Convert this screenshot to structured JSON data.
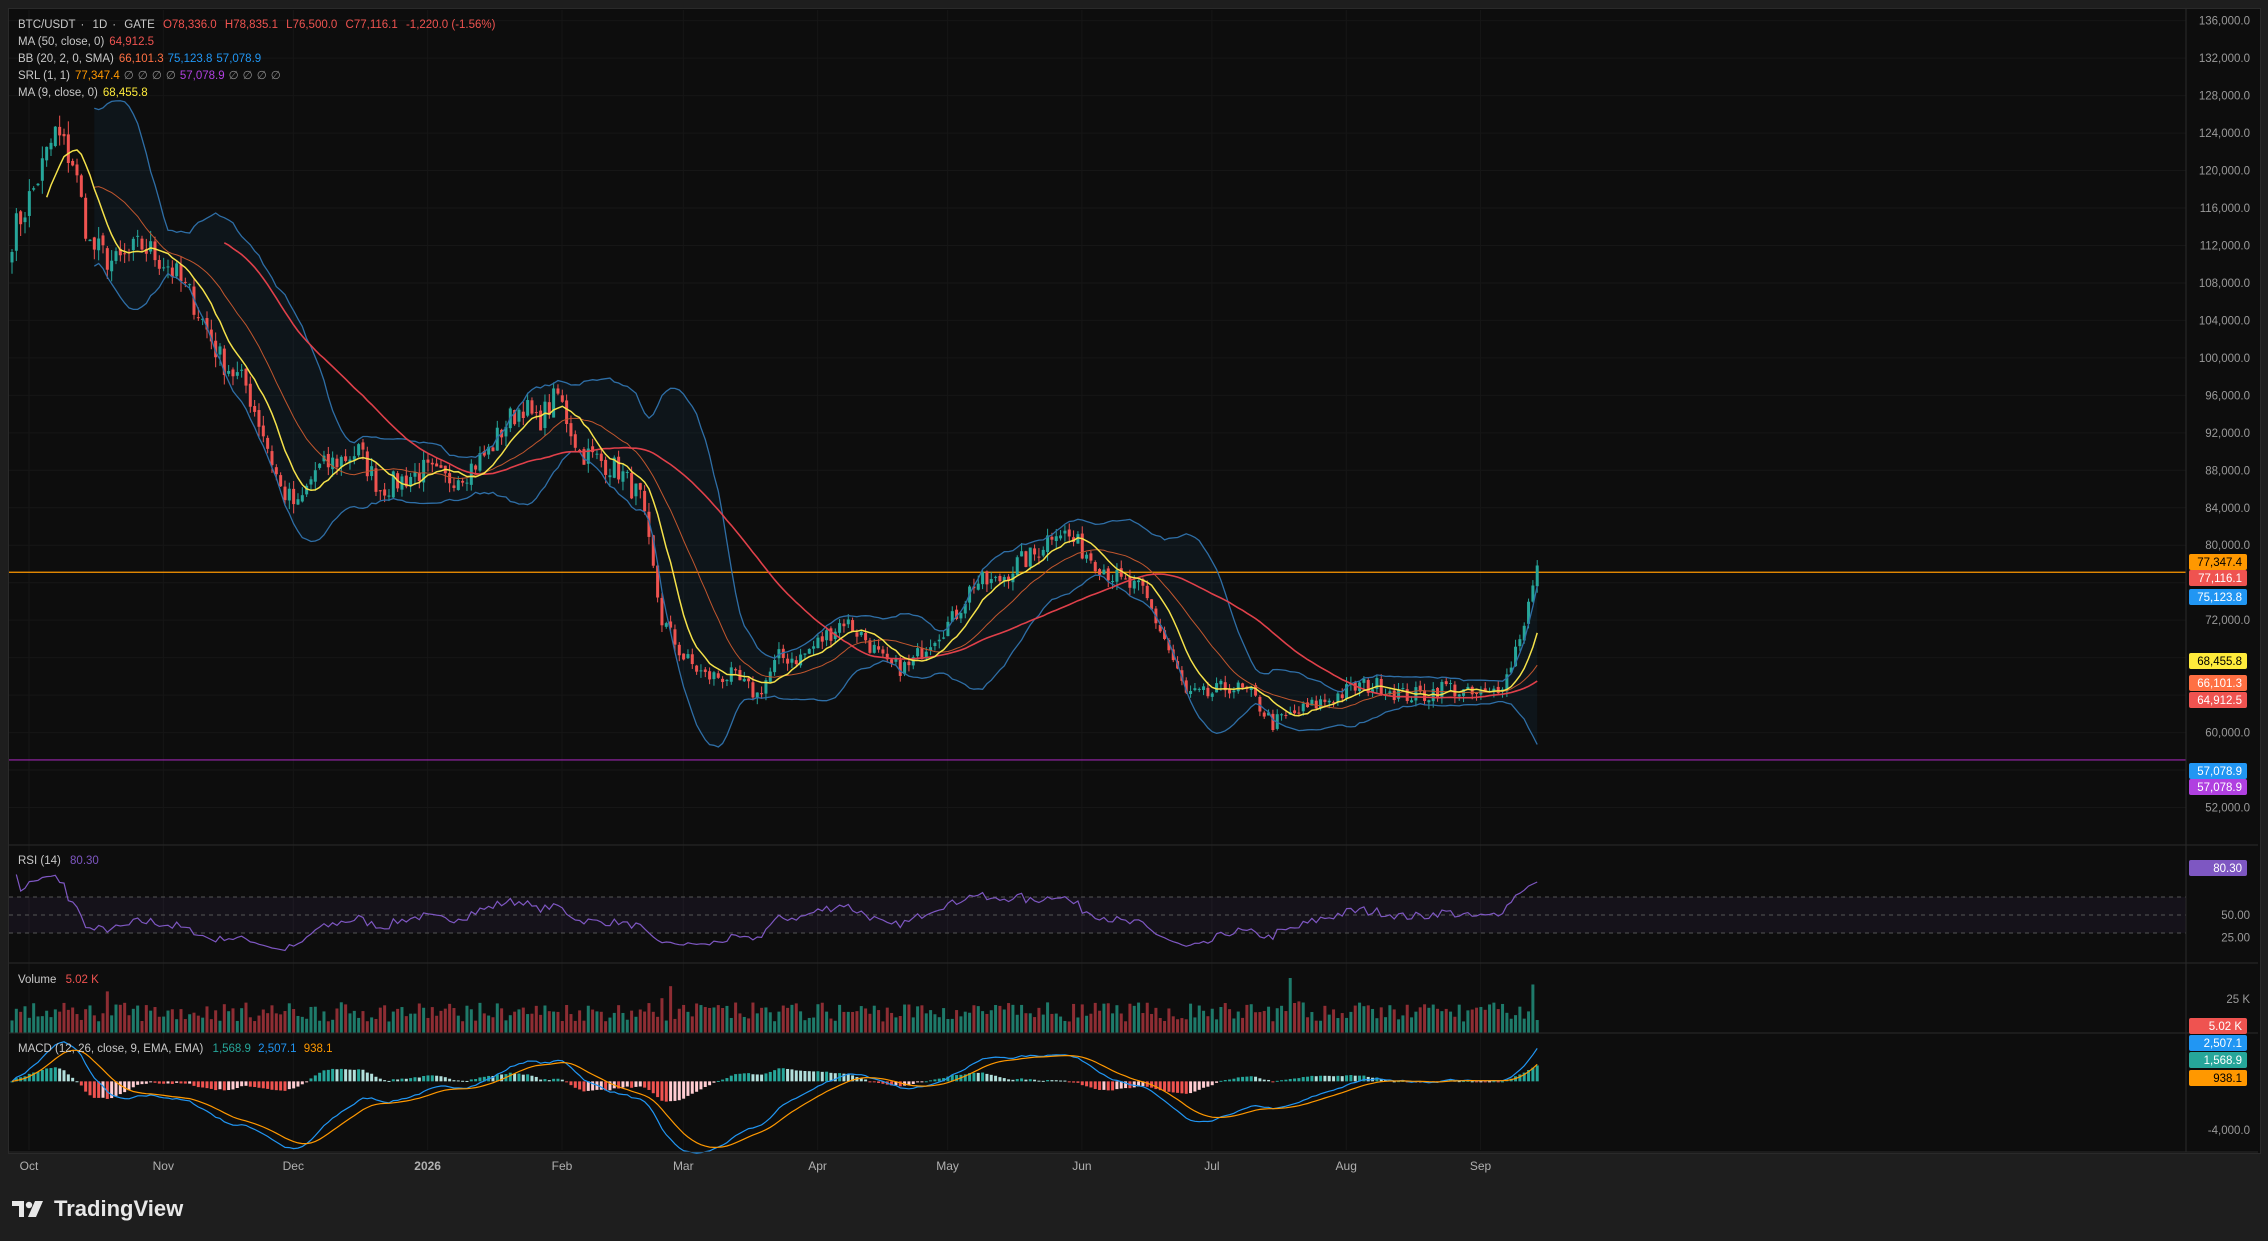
{
  "symbol_legend": {
    "symbol": "BTC/USDT",
    "interval": "1D",
    "exchange": "GATE",
    "open": "O78,336.0",
    "high": "H78,835.1",
    "low": "L76,500.0",
    "close": "C77,116.1",
    "change": "-1,220.0 (-1.56%)"
  },
  "indicators": [
    {
      "name": "MA (50, close, 0)",
      "values": [
        "64,912.5"
      ],
      "colors": [
        "#ef5350"
      ]
    },
    {
      "name": "BB (20, 2, 0, SMA)",
      "values": [
        "66,101.3",
        "75,123.8",
        "57,078.9"
      ],
      "colors": [
        "#ff7043",
        "#2196f3",
        "#2196f3"
      ]
    },
    {
      "name": "SRL (1, 1)",
      "values": [
        "77,347.4",
        "∅",
        "∅",
        "∅",
        "∅",
        "57,078.9",
        "∅",
        "∅",
        "∅",
        "∅"
      ],
      "colors": [
        "#ff9800",
        "#888",
        "#888",
        "#888",
        "#888",
        "#b040e0",
        "#888",
        "#888",
        "#888",
        "#888"
      ]
    },
    {
      "name": "MA (9, close, 0)",
      "values": [
        "68,455.8"
      ],
      "colors": [
        "#ffeb3b"
      ]
    }
  ],
  "rsi_legend": {
    "name": "RSI (14)",
    "value": "80.30"
  },
  "volume_legend": {
    "name": "Volume",
    "value": "5.02 K"
  },
  "macd_legend": {
    "name": "MACD (12, 26, close, 9, EMA, EMA)",
    "values": [
      "1,568.9",
      "2,507.1",
      "938.1"
    ]
  },
  "price_axis_ticks": [
    "136,000.0",
    "132,000.0",
    "128,000.0",
    "124,000.0",
    "120,000.0",
    "116,000.0",
    "112,000.0",
    "108,000.0",
    "104,000.0",
    "100,000.0",
    "96,000.0",
    "92,000.0",
    "88,000.0",
    "84,000.0",
    "80,000.0",
    "72,000.0",
    "60,000.0",
    "52,000.0"
  ],
  "price_badges": [
    {
      "label": "77,347.4",
      "value": 77347.4,
      "color": "#ff9800"
    },
    {
      "label": "77,116.1",
      "value": 77116.1,
      "color": "#ef5350"
    },
    {
      "label": "75,123.8",
      "value": 75123.8,
      "color": "#2196f3"
    },
    {
      "label": "68,455.8",
      "value": 68455.8,
      "color": "#ffeb3b"
    },
    {
      "label": "66,101.3",
      "value": 66101.3,
      "color": "#ff7043"
    },
    {
      "label": "64,912.5",
      "value": 64912.5,
      "color": "#ef5350"
    },
    {
      "label": "57,078.9",
      "value": 57078.9,
      "color": "#2196f3"
    },
    {
      "label": "57,078.9",
      "value": 57078.9,
      "color": "#b040e0"
    }
  ],
  "rsi_axis_ticks": [
    "50.00",
    "25.00"
  ],
  "rsi_badge": {
    "label": "80.30",
    "color": "#7e57c2"
  },
  "volume_axis_ticks": [
    "25 K"
  ],
  "volume_badge": {
    "label": "5.02 K",
    "color": "#ef5350"
  },
  "macd_axis_ticks": [
    "-4,000.0"
  ],
  "macd_badges": [
    {
      "label": "2,507.1",
      "color": "#2196f3"
    },
    {
      "label": "1,568.9",
      "color": "#26a69a"
    },
    {
      "label": "938.1",
      "color": "#ff9800"
    }
  ],
  "time_axis_labels": [
    "Oct",
    "Nov",
    "Dec",
    "2026",
    "Feb",
    "Mar",
    "Apr",
    "May",
    "Jun",
    "Jul",
    "Aug",
    "Sep"
  ],
  "brand": "TradingView",
  "chart_data": {
    "type": "candlestick",
    "price_range": [
      48000,
      136500
    ],
    "horizontal_lines": [
      {
        "value": 77116.1,
        "color": "#ff9800"
      },
      {
        "value": 57078.9,
        "color": "#9c27b0"
      }
    ],
    "close_anchors": [
      [
        0,
        113000
      ],
      [
        5,
        118000
      ],
      [
        10,
        124000
      ],
      [
        14,
        121000
      ],
      [
        18,
        112000
      ],
      [
        24,
        110000
      ],
      [
        30,
        112000
      ],
      [
        36,
        110000
      ],
      [
        42,
        106000
      ],
      [
        48,
        100000
      ],
      [
        54,
        97000
      ],
      [
        58,
        92000
      ],
      [
        62,
        86000
      ],
      [
        66,
        84000
      ],
      [
        70,
        88000
      ],
      [
        75,
        89000
      ],
      [
        80,
        90000
      ],
      [
        85,
        86000
      ],
      [
        90,
        87000
      ],
      [
        95,
        88000
      ],
      [
        100,
        87000
      ],
      [
        105,
        88000
      ],
      [
        110,
        90000
      ],
      [
        114,
        93000
      ],
      [
        118,
        95000
      ],
      [
        121,
        93000
      ],
      [
        126,
        96000
      ],
      [
        131,
        90000
      ],
      [
        136,
        89000
      ],
      [
        140,
        88000
      ],
      [
        145,
        85000
      ],
      [
        150,
        72000
      ],
      [
        155,
        68000
      ],
      [
        160,
        66000
      ],
      [
        166,
        66000
      ],
      [
        172,
        64000
      ],
      [
        177,
        68000
      ],
      [
        182,
        68000
      ],
      [
        187,
        70000
      ],
      [
        192,
        72000
      ],
      [
        197,
        70000
      ],
      [
        202,
        67000
      ],
      [
        207,
        67000
      ],
      [
        212,
        70000
      ],
      [
        217,
        72000
      ],
      [
        222,
        76000
      ],
      [
        227,
        76000
      ],
      [
        232,
        78000
      ],
      [
        236,
        79000
      ],
      [
        241,
        82000
      ],
      [
        246,
        80000
      ],
      [
        251,
        78000
      ],
      [
        256,
        76000
      ],
      [
        261,
        75000
      ],
      [
        266,
        70000
      ],
      [
        271,
        64000
      ],
      [
        276,
        64000
      ],
      [
        281,
        65000
      ],
      [
        286,
        64000
      ],
      [
        291,
        61000
      ],
      [
        296,
        62000
      ],
      [
        301,
        63000
      ],
      [
        306,
        64000
      ],
      [
        311,
        65000
      ],
      [
        316,
        65000
      ],
      [
        321,
        64000
      ],
      [
        326,
        64000
      ],
      [
        331,
        65000
      ],
      [
        336,
        64000
      ],
      [
        341,
        64000
      ],
      [
        345,
        66000
      ],
      [
        349,
        72000
      ],
      [
        352,
        77116
      ]
    ],
    "rsi_range": [
      0,
      100
    ],
    "macd_range": [
      -5500,
      3000
    ]
  }
}
